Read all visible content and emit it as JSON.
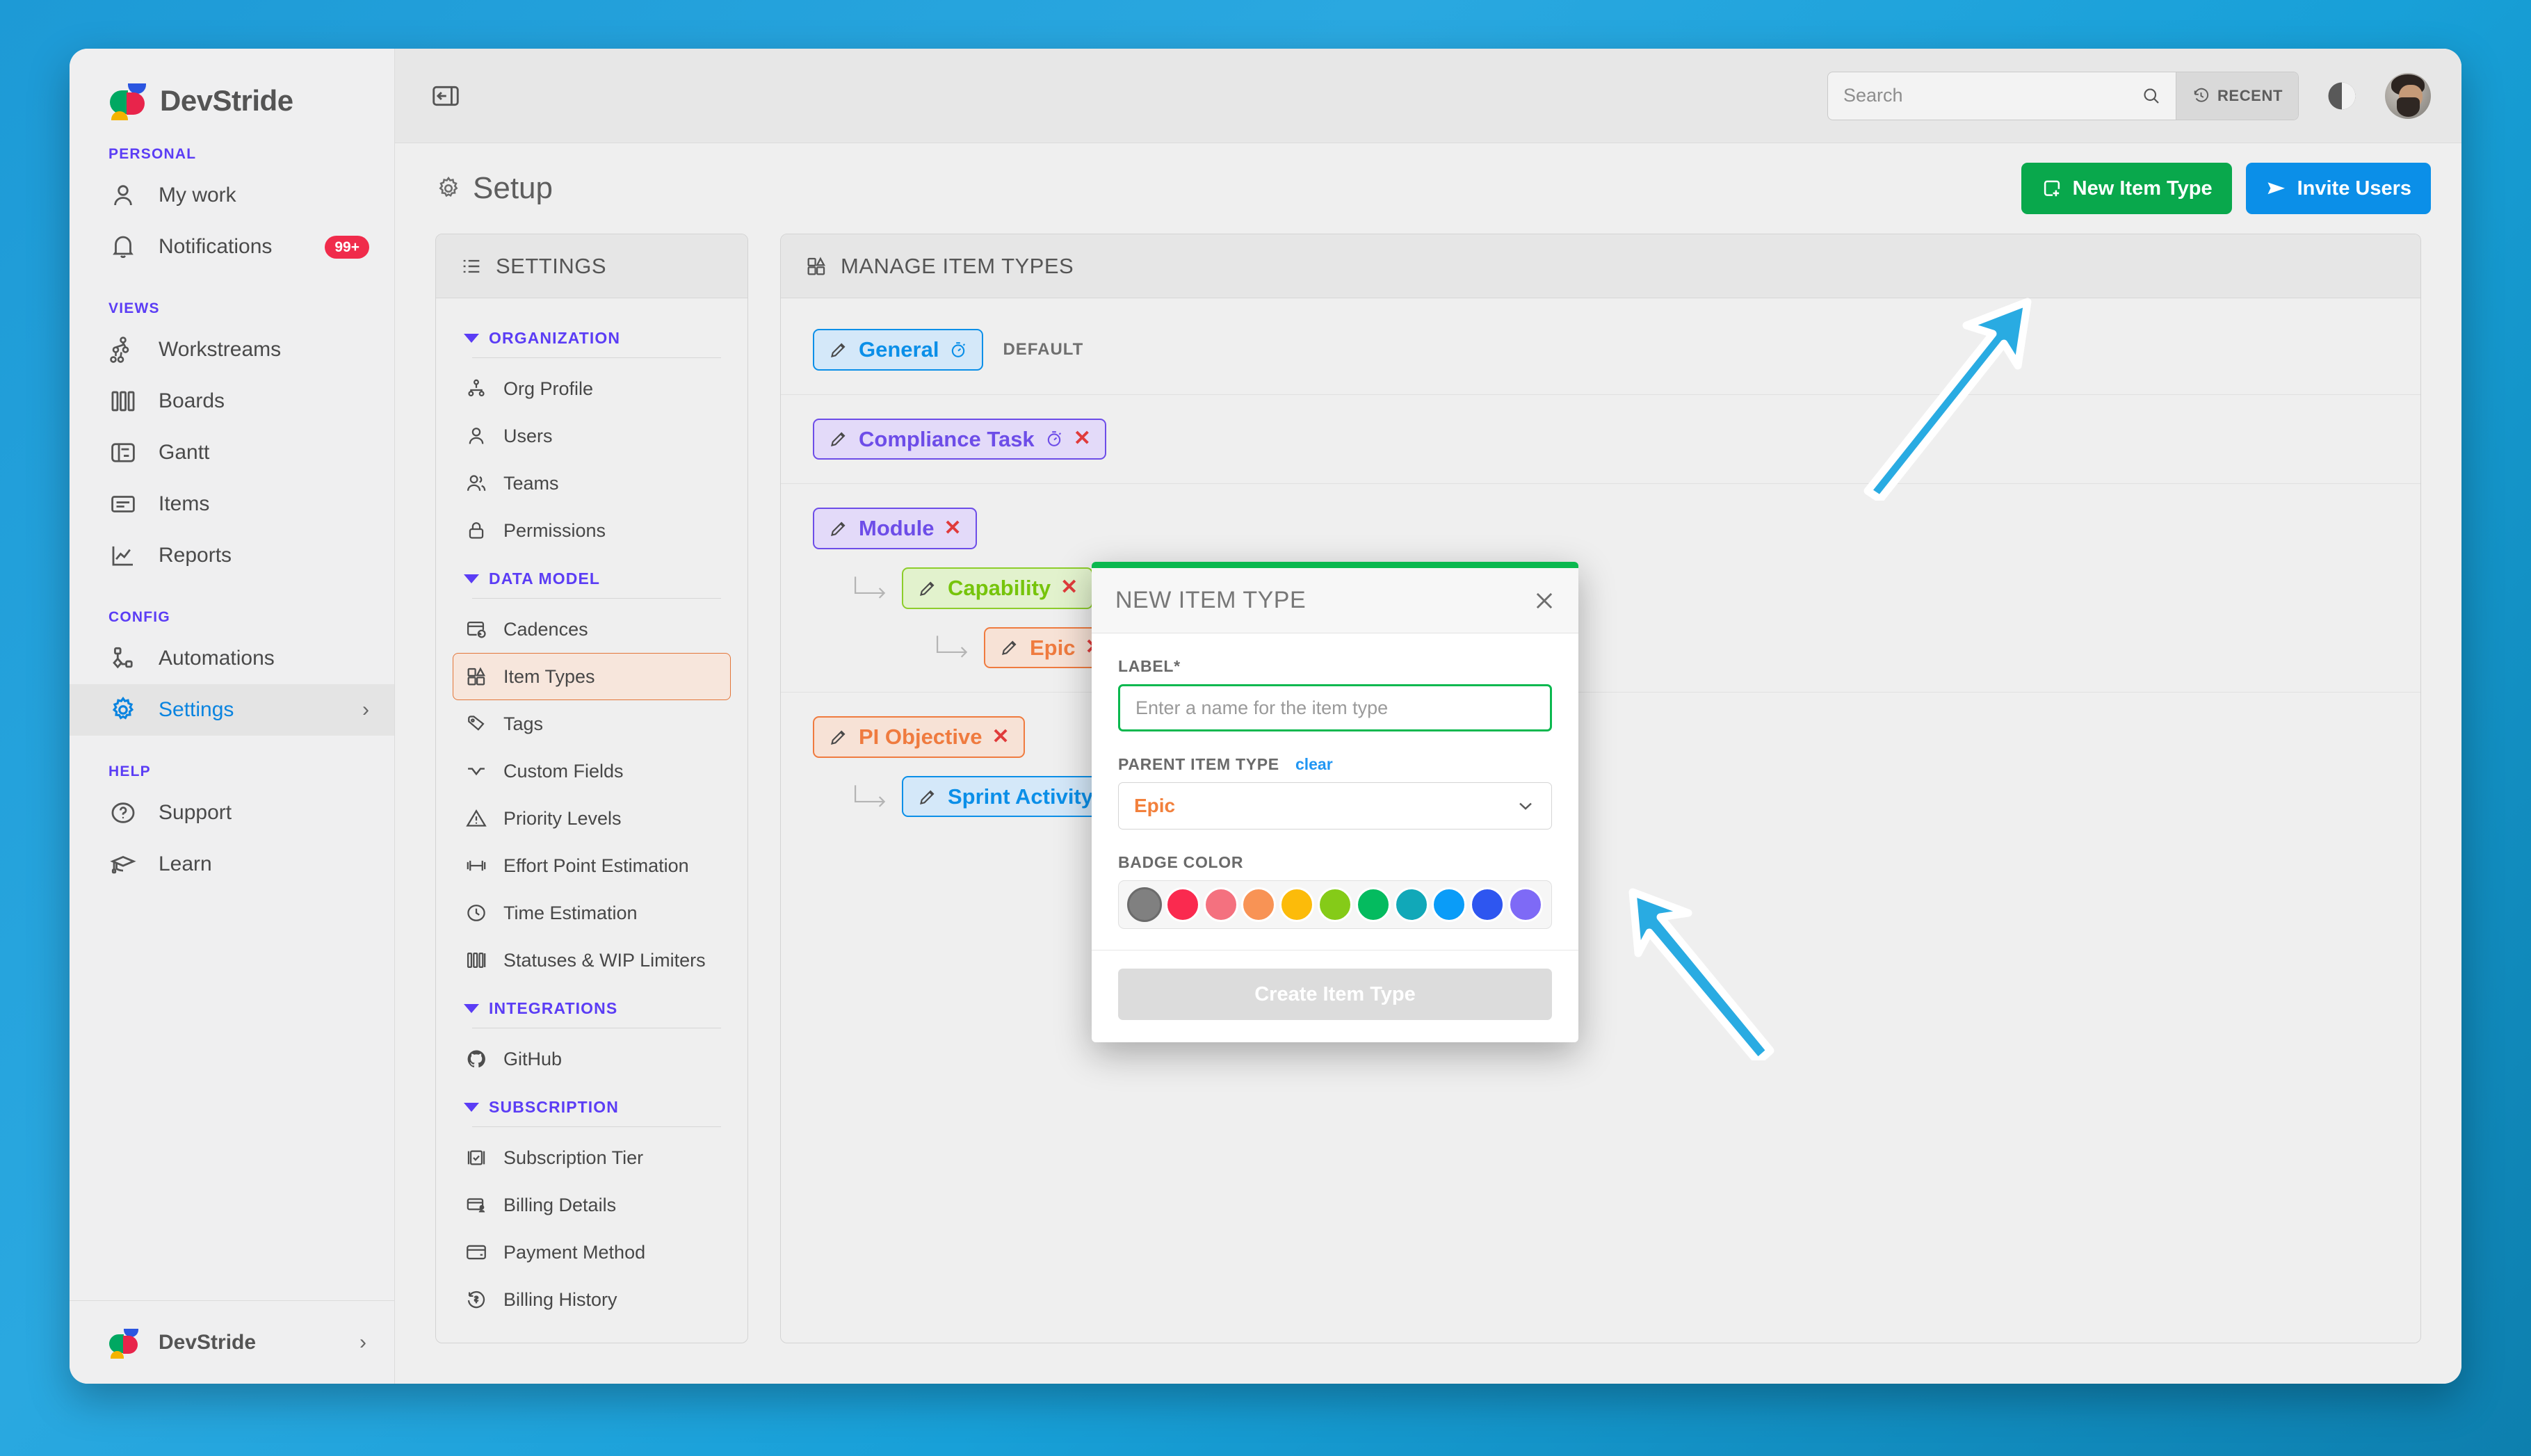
{
  "theme": {
    "accent_green": "#09a84c",
    "accent_blue": "#0b8fe8",
    "accent_purple": "#5b3df5",
    "accent_orange": "#e2763a",
    "annotation_arrow": "#29abe2"
  },
  "sidebar": {
    "brand": "DevStride",
    "sections": [
      {
        "label": "PERSONAL",
        "items": [
          {
            "label": "My work",
            "icon": "user-icon",
            "badge": null,
            "active": false
          },
          {
            "label": "Notifications",
            "icon": "bell-icon",
            "badge": "99+",
            "active": false
          }
        ]
      },
      {
        "label": "VIEWS",
        "items": [
          {
            "label": "Workstreams",
            "icon": "workstreams-icon",
            "badge": null,
            "active": false
          },
          {
            "label": "Boards",
            "icon": "boards-icon",
            "badge": null,
            "active": false
          },
          {
            "label": "Gantt",
            "icon": "gantt-icon",
            "badge": null,
            "active": false
          },
          {
            "label": "Items",
            "icon": "items-icon",
            "badge": null,
            "active": false
          },
          {
            "label": "Reports",
            "icon": "reports-icon",
            "badge": null,
            "active": false
          }
        ]
      },
      {
        "label": "CONFIG",
        "items": [
          {
            "label": "Automations",
            "icon": "automations-icon",
            "badge": null,
            "active": false
          },
          {
            "label": "Settings",
            "icon": "gear-icon",
            "badge": null,
            "active": true,
            "chevron": "›"
          }
        ]
      },
      {
        "label": "HELP",
        "items": [
          {
            "label": "Support",
            "icon": "question-circle-icon",
            "badge": null,
            "active": false
          },
          {
            "label": "Learn",
            "icon": "graduation-cap-icon",
            "badge": null,
            "active": false
          }
        ]
      }
    ],
    "footer": {
      "label": "DevStride",
      "chevron": "›"
    }
  },
  "topbar": {
    "collapse_icon": "collapse-sidebar-icon",
    "search": {
      "value": "",
      "placeholder": "Search",
      "icon": "search-icon"
    },
    "recent_label": "RECENT",
    "recent_icon": "history-clock-icon",
    "theme_toggle_icon": "contrast-half-circle-icon",
    "avatar_icon": "avatar"
  },
  "page": {
    "title": "Setup",
    "title_icon": "gear-icon",
    "actions": [
      {
        "label": "New Item Type",
        "icon": "add-square-icon",
        "style": "green"
      },
      {
        "label": "Invite Users",
        "icon": "send-paper-plane-icon",
        "style": "blue"
      }
    ]
  },
  "settings_panel": {
    "header": "SETTINGS",
    "header_icon": "list-settings-icon",
    "groups": [
      {
        "name": "ORGANIZATION",
        "items": [
          {
            "label": "Org Profile",
            "icon": "org-tree-icon",
            "selected": false
          },
          {
            "label": "Users",
            "icon": "user-icon",
            "selected": false
          },
          {
            "label": "Teams",
            "icon": "users-group-icon",
            "selected": false
          },
          {
            "label": "Permissions",
            "icon": "lock-icon",
            "selected": false
          }
        ]
      },
      {
        "name": "DATA MODEL",
        "items": [
          {
            "label": "Cadences",
            "icon": "cadence-refresh-icon",
            "selected": false
          },
          {
            "label": "Item Types",
            "icon": "item-types-icon",
            "selected": true
          },
          {
            "label": "Tags",
            "icon": "tag-icon",
            "selected": false
          },
          {
            "label": "Custom Fields",
            "icon": "custom-fields-icon",
            "selected": false
          },
          {
            "label": "Priority Levels",
            "icon": "warning-triangle-icon",
            "selected": false
          },
          {
            "label": "Effort Point Estimation",
            "icon": "dumbbell-icon",
            "selected": false
          },
          {
            "label": "Time Estimation",
            "icon": "clock-icon",
            "selected": false
          },
          {
            "label": "Statuses & WIP Limiters",
            "icon": "columns-icon",
            "selected": false
          }
        ]
      },
      {
        "name": "INTEGRATIONS",
        "items": [
          {
            "label": "GitHub",
            "icon": "github-icon",
            "selected": false
          }
        ]
      },
      {
        "name": "SUBSCRIPTION",
        "items": [
          {
            "label": "Subscription Tier",
            "icon": "subscription-check-icon",
            "selected": false
          },
          {
            "label": "Billing Details",
            "icon": "billing-card-icon",
            "selected": false
          },
          {
            "label": "Payment Method",
            "icon": "credit-card-icon",
            "selected": false
          },
          {
            "label": "Billing History",
            "icon": "billing-history-icon",
            "selected": false
          }
        ]
      }
    ]
  },
  "item_types_panel": {
    "header": "MANAGE ITEM TYPES",
    "header_icon": "item-types-icon",
    "rows": [
      {
        "chips": [
          {
            "label": "General",
            "color": "#0b8fe8",
            "bg": "#d4e8f9",
            "level": 0,
            "has_timer": true,
            "has_delete": false,
            "tag": "DEFAULT"
          }
        ]
      },
      {
        "chips": [
          {
            "label": "Compliance Task",
            "color": "#6d4de8",
            "bg": "#e3daf9",
            "level": 0,
            "has_timer": true,
            "has_delete": true,
            "tag": null
          }
        ]
      },
      {
        "chips": [
          {
            "label": "Module",
            "color": "#6d4de8",
            "bg": "#e3daf9",
            "level": 0,
            "has_timer": false,
            "has_delete": true,
            "tag": null
          },
          {
            "label": "Capability",
            "color": "#76c40b",
            "bg": "#e2f2cd",
            "level": 1,
            "has_timer": false,
            "has_delete": true,
            "tag": null
          },
          {
            "label": "Epic",
            "color": "#ef7b3f",
            "bg": "#f7e2d6",
            "level": 2,
            "has_timer": false,
            "has_delete": true,
            "tag": null
          }
        ]
      },
      {
        "chips": [
          {
            "label": "PI Objective",
            "color": "#ef7b3f",
            "bg": "#f7e2d6",
            "level": 0,
            "has_timer": false,
            "has_delete": true,
            "tag": null
          },
          {
            "label": "Sprint Activity",
            "color": "#0b8fe8",
            "bg": "#d4e8f9",
            "level": 1,
            "has_timer": true,
            "has_delete": true,
            "tag": null
          }
        ]
      }
    ]
  },
  "modal": {
    "title": "NEW ITEM TYPE",
    "close_icon": "close-icon",
    "label_field": {
      "label": "LABEL*",
      "value": "",
      "placeholder": "Enter a name for the item type"
    },
    "parent_field": {
      "label": "PARENT ITEM TYPE",
      "clear_label": "clear",
      "selected": "Epic",
      "options": [
        "Epic"
      ],
      "chevron_icon": "chevron-down-icon"
    },
    "badge_color": {
      "label": "BADGE COLOR",
      "selected_index": 0,
      "swatches": [
        "#808080",
        "#fa2a4f",
        "#f4717f",
        "#f89355",
        "#fcbb0a",
        "#85cb18",
        "#04bb5f",
        "#11a8b8",
        "#0a9cf8",
        "#2e56f0",
        "#7e6af6"
      ]
    },
    "submit_label": "Create Item Type"
  },
  "annotations": [
    {
      "name": "arrow-to-new-item-type-button",
      "color": "#29abe2"
    },
    {
      "name": "arrow-to-modal",
      "color": "#29abe2"
    }
  ]
}
